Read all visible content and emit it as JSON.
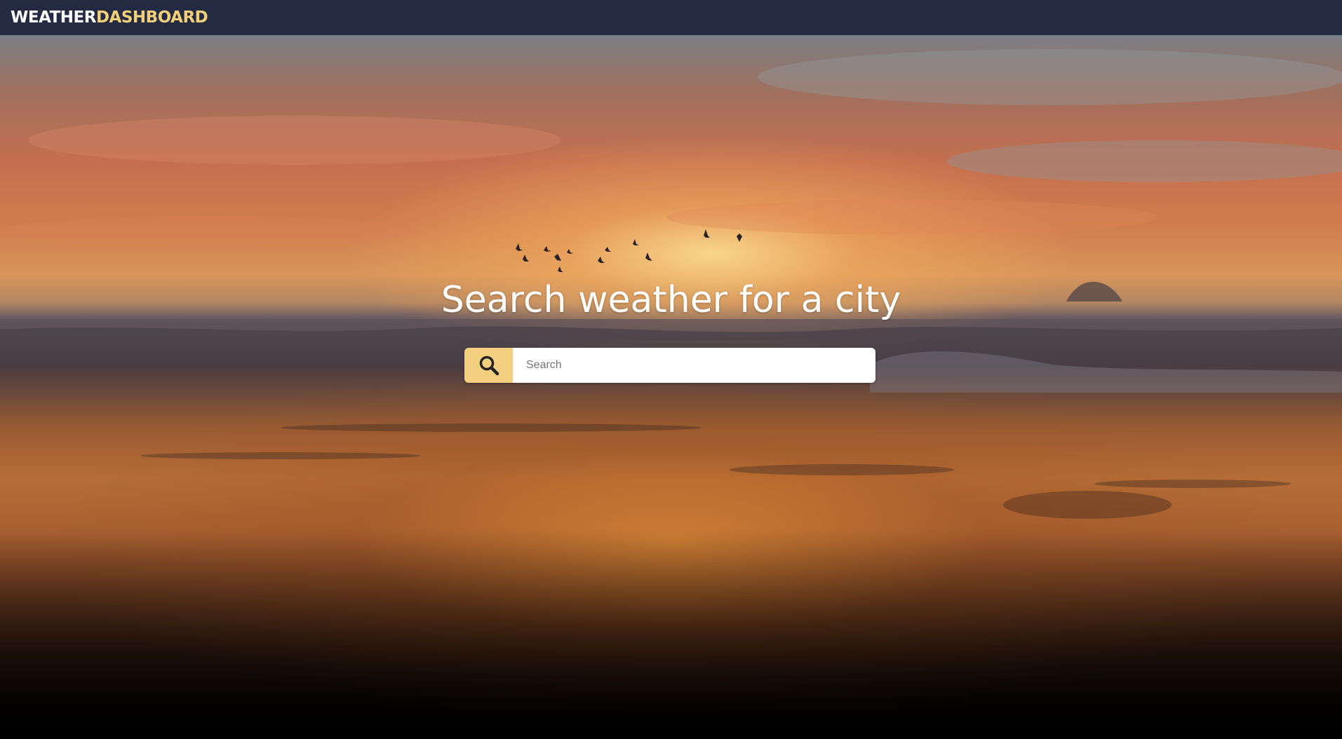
{
  "navbar": {
    "brand_part1": "WEATHER",
    "brand_part2": "DASHBOARD"
  },
  "hero": {
    "title": "Search weather for a city",
    "background": "sunset-over-ocean-with-birds"
  },
  "search": {
    "placeholder": "Search",
    "value": "",
    "button_icon": "search-icon"
  },
  "colors": {
    "navbar_bg": "#242a41",
    "brand_primary": "#ffffff",
    "brand_accent": "#f3cf7a",
    "search_button_bg": "#f3d07f",
    "title_color": "#ffffff"
  }
}
